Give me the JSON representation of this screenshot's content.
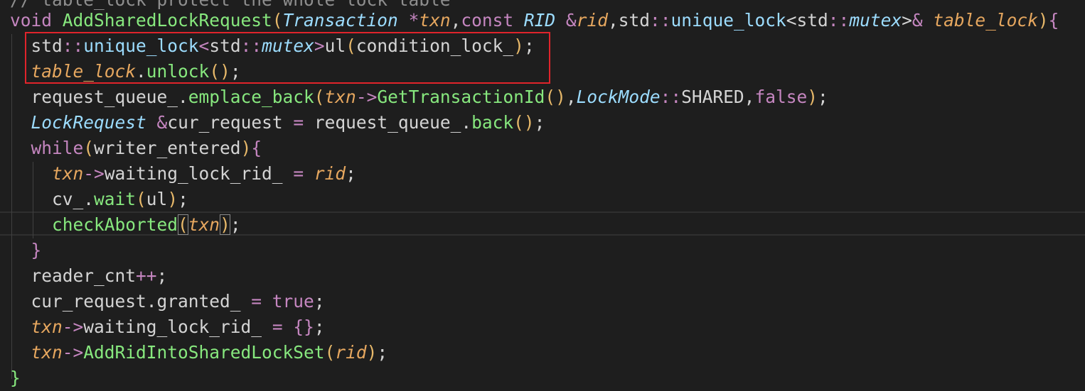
{
  "colors": {
    "background": "#1e1e1e",
    "default_text": "#d4d4d4",
    "keyword": "#c586c0",
    "type": "#9cdcfe",
    "function": "#87e87e",
    "parameter": "#e6a75f",
    "highlight_box": "#e0242b"
  },
  "code": {
    "lines": [
      {
        "tokens": [
          {
            "t": "// table_lock protect the whole lock table",
            "c": "cm"
          }
        ]
      },
      {
        "tokens": [
          {
            "t": "void ",
            "c": "kw"
          },
          {
            "t": "AddSharedLockRequest",
            "c": "fn"
          },
          {
            "t": "(",
            "c": "pn"
          },
          {
            "t": "Transaction",
            "c": "tyi"
          },
          {
            "t": " ",
            "c": "tx"
          },
          {
            "t": "*",
            "c": "op"
          },
          {
            "t": "txn",
            "c": "pa"
          },
          {
            "t": ",",
            "c": "tx"
          },
          {
            "t": "const ",
            "c": "kw"
          },
          {
            "t": "RID",
            "c": "tyi"
          },
          {
            "t": " ",
            "c": "tx"
          },
          {
            "t": "&",
            "c": "op"
          },
          {
            "t": "rid",
            "c": "pa"
          },
          {
            "t": ",",
            "c": "tx"
          },
          {
            "t": "std",
            "c": "tx"
          },
          {
            "t": "::",
            "c": "op"
          },
          {
            "t": "unique_lock",
            "c": "ty"
          },
          {
            "t": "<",
            "c": "tx"
          },
          {
            "t": "std",
            "c": "tx"
          },
          {
            "t": "::",
            "c": "op"
          },
          {
            "t": "mutex",
            "c": "tyi"
          },
          {
            "t": ">",
            "c": "tx"
          },
          {
            "t": "&",
            "c": "op"
          },
          {
            "t": " ",
            "c": "tx"
          },
          {
            "t": "table_lock",
            "c": "pa"
          },
          {
            "t": ")",
            "c": "pn"
          },
          {
            "t": "{",
            "c": "br"
          }
        ]
      },
      {
        "tokens": [
          {
            "t": "  std",
            "c": "tx"
          },
          {
            "t": "::",
            "c": "op"
          },
          {
            "t": "unique_lock",
            "c": "ty"
          },
          {
            "t": "<",
            "c": "op"
          },
          {
            "t": "std",
            "c": "tx"
          },
          {
            "t": "::",
            "c": "op"
          },
          {
            "t": "mutex",
            "c": "tyi"
          },
          {
            "t": ">",
            "c": "op"
          },
          {
            "t": "ul",
            "c": "tx"
          },
          {
            "t": "(",
            "c": "pn"
          },
          {
            "t": "condition_lock_",
            "c": "tx"
          },
          {
            "t": ")",
            "c": "pn"
          },
          {
            "t": ";",
            "c": "tx"
          }
        ]
      },
      {
        "tokens": [
          {
            "t": "  ",
            "c": "tx"
          },
          {
            "t": "table_lock",
            "c": "pa"
          },
          {
            "t": ".",
            "c": "tx"
          },
          {
            "t": "unlock",
            "c": "fn"
          },
          {
            "t": "()",
            "c": "pn"
          },
          {
            "t": ";",
            "c": "tx"
          }
        ]
      },
      {
        "tokens": [
          {
            "t": "  request_queue_.",
            "c": "tx"
          },
          {
            "t": "emplace_back",
            "c": "fn"
          },
          {
            "t": "(",
            "c": "pn"
          },
          {
            "t": "txn",
            "c": "pa"
          },
          {
            "t": "->",
            "c": "op"
          },
          {
            "t": "GetTransactionId",
            "c": "fn"
          },
          {
            "t": "()",
            "c": "pn"
          },
          {
            "t": ",",
            "c": "tx"
          },
          {
            "t": "LockMode",
            "c": "tyi"
          },
          {
            "t": "::",
            "c": "op"
          },
          {
            "t": "SHARED",
            "c": "tx"
          },
          {
            "t": ",",
            "c": "tx"
          },
          {
            "t": "false",
            "c": "lit"
          },
          {
            "t": ")",
            "c": "pn"
          },
          {
            "t": ";",
            "c": "tx"
          }
        ]
      },
      {
        "tokens": [
          {
            "t": "  ",
            "c": "tx"
          },
          {
            "t": "LockRequest",
            "c": "tyi"
          },
          {
            "t": " ",
            "c": "tx"
          },
          {
            "t": "&",
            "c": "op"
          },
          {
            "t": "cur_request ",
            "c": "tx"
          },
          {
            "t": "=",
            "c": "op"
          },
          {
            "t": " request_queue_.",
            "c": "tx"
          },
          {
            "t": "back",
            "c": "fn"
          },
          {
            "t": "()",
            "c": "pn"
          },
          {
            "t": ";",
            "c": "tx"
          }
        ]
      },
      {
        "tokens": [
          {
            "t": "  ",
            "c": "tx"
          },
          {
            "t": "while",
            "c": "kw"
          },
          {
            "t": "(",
            "c": "pn"
          },
          {
            "t": "writer_entered",
            "c": "tx"
          },
          {
            "t": ")",
            "c": "pn"
          },
          {
            "t": "{",
            "c": "br"
          }
        ]
      },
      {
        "tokens": [
          {
            "t": "    ",
            "c": "tx"
          },
          {
            "t": "txn",
            "c": "pa"
          },
          {
            "t": "->",
            "c": "op"
          },
          {
            "t": "waiting_lock_rid_ ",
            "c": "tx"
          },
          {
            "t": "=",
            "c": "op"
          },
          {
            "t": " ",
            "c": "tx"
          },
          {
            "t": "rid",
            "c": "pa"
          },
          {
            "t": ";",
            "c": "tx"
          }
        ]
      },
      {
        "tokens": [
          {
            "t": "    cv_.",
            "c": "tx"
          },
          {
            "t": "wait",
            "c": "fn"
          },
          {
            "t": "(",
            "c": "pn"
          },
          {
            "t": "ul",
            "c": "tx"
          },
          {
            "t": ")",
            "c": "pn"
          },
          {
            "t": ";",
            "c": "tx"
          }
        ]
      },
      {
        "tokens": [
          {
            "t": "    ",
            "c": "tx"
          },
          {
            "t": "checkAborted",
            "c": "fn"
          },
          {
            "t": "(",
            "c": "pn",
            "m": true
          },
          {
            "t": "txn",
            "c": "pa"
          },
          {
            "t": ")",
            "c": "pn",
            "m": true
          },
          {
            "t": ";",
            "c": "tx"
          }
        ]
      },
      {
        "tokens": [
          {
            "t": "  ",
            "c": "tx"
          },
          {
            "t": "}",
            "c": "br"
          }
        ]
      },
      {
        "tokens": [
          {
            "t": "  reader_cnt",
            "c": "tx"
          },
          {
            "t": "++",
            "c": "op"
          },
          {
            "t": ";",
            "c": "tx"
          }
        ]
      },
      {
        "tokens": [
          {
            "t": "  cur_request.granted_ ",
            "c": "tx"
          },
          {
            "t": "=",
            "c": "op"
          },
          {
            "t": " ",
            "c": "tx"
          },
          {
            "t": "true",
            "c": "lit"
          },
          {
            "t": ";",
            "c": "tx"
          }
        ]
      },
      {
        "tokens": [
          {
            "t": "  ",
            "c": "tx"
          },
          {
            "t": "txn",
            "c": "pa"
          },
          {
            "t": "->",
            "c": "op"
          },
          {
            "t": "waiting_lock_rid_ ",
            "c": "tx"
          },
          {
            "t": "=",
            "c": "op"
          },
          {
            "t": " ",
            "c": "tx"
          },
          {
            "t": "{}",
            "c": "br"
          },
          {
            "t": ";",
            "c": "tx"
          }
        ]
      },
      {
        "tokens": [
          {
            "t": "  ",
            "c": "tx"
          },
          {
            "t": "txn",
            "c": "pa"
          },
          {
            "t": "->",
            "c": "op"
          },
          {
            "t": "AddRidIntoSharedLockSet",
            "c": "fn"
          },
          {
            "t": "(",
            "c": "pn"
          },
          {
            "t": "rid",
            "c": "pa"
          },
          {
            "t": ")",
            "c": "pn"
          },
          {
            "t": ";",
            "c": "tx"
          }
        ]
      },
      {
        "tokens": [
          {
            "t": "}",
            "c": "fn"
          }
        ]
      }
    ]
  }
}
